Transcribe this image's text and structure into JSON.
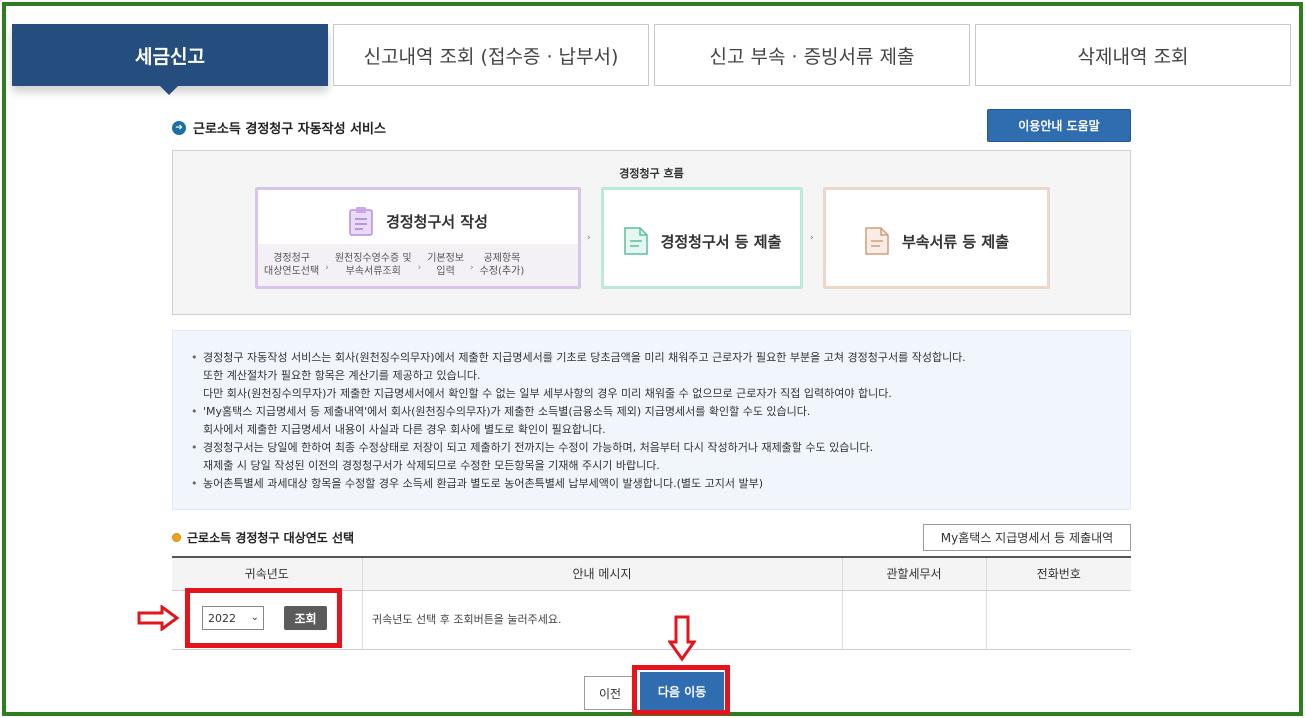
{
  "tabs": [
    {
      "label": "세금신고",
      "active": true
    },
    {
      "label": "신고내역 조회 (접수증 · 납부서)",
      "active": false
    },
    {
      "label": "신고 부속 · 증빙서류 제출",
      "active": false
    },
    {
      "label": "삭제내역 조회",
      "active": false
    }
  ],
  "section": {
    "title": "근로소득 경정청구 자동작성 서비스",
    "help_button": "이용안내 도움말"
  },
  "flow": {
    "title": "경정청구 흐름",
    "step1": {
      "label": "경정청구서 작성",
      "substeps": [
        [
          "경정청구",
          "대상연도선택"
        ],
        [
          "원천징수영수증 및",
          "부속서류조회"
        ],
        [
          "기본정보",
          "입력"
        ],
        [
          "공제항목",
          "수정(추가)"
        ]
      ]
    },
    "step2": {
      "label": "경정청구서 등 제출"
    },
    "step3": {
      "label": "부속서류 등 제출"
    }
  },
  "info": {
    "lines": [
      {
        "text": "경정청구 자동작성 서비스는 회사(원천징수의무자)에서 제출한 지급명세서를 기초로 당초금액을 미리 채워주고 근로자가 필요한 부분을 고쳐 경정청구서를 작성합니다.",
        "bullet": true
      },
      {
        "text": "또한 계산절차가 필요한 항목은 계산기를 제공하고 있습니다.",
        "bullet": false
      },
      {
        "text": "다만 회사(원천징수의무자)가 제출한 지급명세서에서 확인할 수 없는 일부 세부사항의 경우 미리 채워줄 수 없으므로 근로자가 직접 입력하여야 합니다.",
        "bullet": false
      },
      {
        "text": "'My홈택스 지급명세서 등 제출내역'에서 회사(원천징수의무자)가 제출한 소득별(금융소득 제외) 지급명세서를 확인할 수도 있습니다.",
        "bullet": true
      },
      {
        "text": "회사에서 제출한 지급명세서 내용이 사실과 다른 경우 회사에 별도로 확인이 필요합니다.",
        "bullet": false
      },
      {
        "text": "경정청구서는 당일에 한하여 최종 수정상태로 저장이 되고 제출하기 전까지는 수정이 가능하며, 처음부터 다시 작성하거나 재제출할 수도 있습니다.",
        "bullet": true
      },
      {
        "text": "재제출 시 당일 작성된 이전의 경정청구서가 삭제되므로 수정한 모든항목을 기재해 주시기 바랍니다.",
        "bullet": false
      },
      {
        "text": "농어촌특별세 과세대상 항목을 수정할 경우 소득세 환급과 별도로 농어촌특별세 납부세액이 발생합니다.(별도 고지서 발부)",
        "bullet": true
      }
    ]
  },
  "year_section": {
    "title": "근로소득 경정청구 대상연도 선택",
    "myhometax_button": "My홈택스 지급명세서 등 제출내역",
    "headers": [
      "귀속년도",
      "안내 메시지",
      "관할세무서",
      "전화번호"
    ],
    "selected_year": "2022",
    "query_button": "조회",
    "message": "귀속년도 선택 후 조회버튼을 눌러주세요."
  },
  "buttons": {
    "prev": "이전",
    "next": "다음 이동"
  },
  "colors": {
    "active_tab": "#254e7f",
    "primary_button": "#2f6db0",
    "highlight": "#e3141b",
    "frame": "#2e7d1f"
  }
}
